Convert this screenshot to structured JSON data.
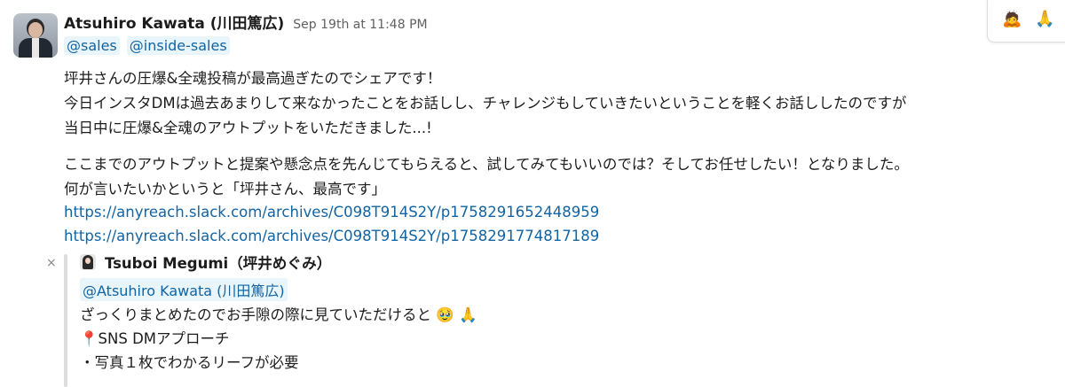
{
  "message": {
    "author": "Atsuhiro Kawata (川田篤広)",
    "timestamp": "Sep 19th at 11:48 PM",
    "mentions": [
      "@sales",
      "@inside-sales"
    ],
    "reactions": [
      {
        "emoji": "🙇",
        "icon": "bowing-person-icon"
      },
      {
        "emoji": "🙏",
        "icon": "folded-hands-icon"
      }
    ],
    "lines": [
      "坪井さんの圧爆&全魂投稿が最高過ぎたのでシェアです！",
      "今日インスタDMは過去あまりして来なかったことをお話しし、チャレンジもしていきたいということを軽くお話ししたのですが",
      "当日中に圧爆&全魂のアウトプットをいただきました...!",
      "ここまでのアウトプットと提案や懸念点を先んじてもらえると、試してみてもいいのでは？そしてお任せしたい！となりました。",
      "何が言いたいかというと「坪井さん、最高です」"
    ],
    "links": [
      "https://anyreach.slack.com/archives/C098T914S2Y/p1758291652448959",
      "https://anyreach.slack.com/archives/C098T914S2Y/p1758291774817189"
    ]
  },
  "quoted": {
    "close": "×",
    "author": "Tsuboi  Megumi（坪井めぐみ）",
    "mention": "@Atsuhiro Kawata (川田篤広)",
    "line1": "ざっくりまとめたのでお手隙の際に見ていただけると",
    "line1_emojis": "🥹 🙏",
    "pin": "📍",
    "line2": "SNS DMアプローチ",
    "line3": "・写真１枚でわかるリーフが必要"
  }
}
